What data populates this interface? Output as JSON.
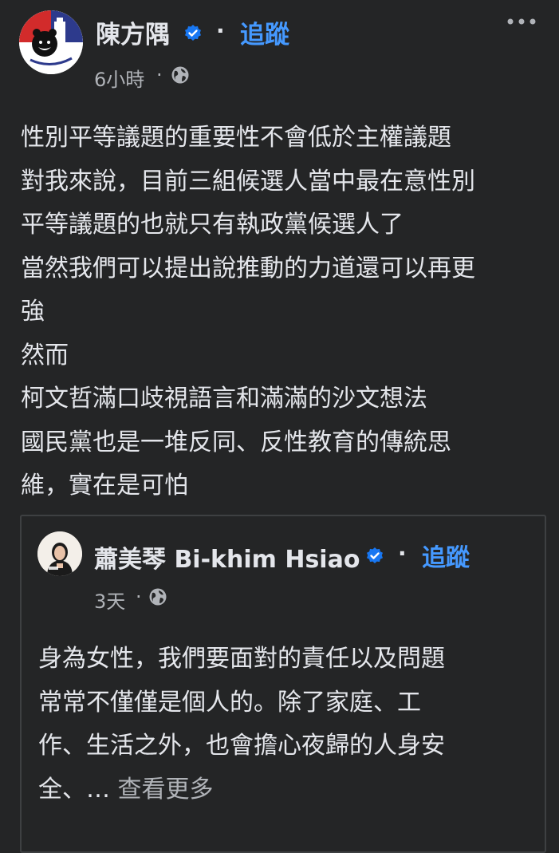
{
  "post": {
    "author": "陳方隅",
    "follow_label": "追蹤",
    "separator": "·",
    "time": "6小時",
    "meta_separator": "·",
    "lines": [
      "性別平等議題的重要性不會低於主權議題",
      "對我來說，目前三組候選人當中最在意性別",
      "平等議題的也就只有執政黨候選人了",
      "當然我們可以提出說推動的力道還可以再更",
      "強",
      "然而",
      "柯文哲滿口歧視語言和滿滿的沙文想法",
      "國民黨也是一堆反同、反性教育的傳統思",
      "維，實在是可怕"
    ]
  },
  "shared_post": {
    "author": "蕭美琴 Bi-khim Hsiao",
    "follow_label": "追蹤",
    "separator": "·",
    "time": "3天",
    "meta_separator": "·",
    "lines": [
      "身為女性，我們要面對的責任以及問題",
      "常常不僅僅是個人的。除了家庭、工",
      "作、生活之外，也會擔心夜歸的人身安"
    ],
    "last_line_text": "全、…",
    "see_more_label": "查看更多"
  },
  "colors": {
    "background": "#242526",
    "text": "#e4e6eb",
    "secondary": "#b0b3b8",
    "link": "#4599ff",
    "verified": "#1877f2"
  },
  "icons": [
    "verified-badge-icon",
    "globe-icon",
    "more-options-icon"
  ]
}
